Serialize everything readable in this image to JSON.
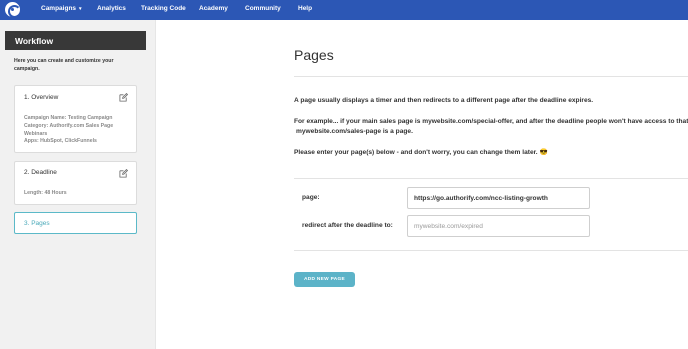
{
  "nav": {
    "items": [
      "Campaigns",
      "Analytics",
      "Tracking Code",
      "Academy",
      "Community",
      "Help"
    ],
    "campaigns_caret": "▾",
    "bg_color": "#2c57b5"
  },
  "sidebar": {
    "heading": "Workflow",
    "description": "Here you can create and customize your campaign.",
    "overview": {
      "title": "1. Overview",
      "campaign_name": "Campaign Name: Testing Campaign",
      "category": "Category: Authorify.com Sales Page Webinars",
      "apps": "Apps: HubSpot, ClickFunnels"
    },
    "deadline": {
      "title": "2. Deadline",
      "length": "Length: 48 Hours"
    },
    "pages": {
      "title": "3. Pages"
    }
  },
  "main": {
    "title": "Pages",
    "para1": "A page usually displays a timer and then redirects to a different page after the deadline expires.",
    "para2_line1": "For example... if your main sales page is mywebsite.com/special-offer, and after the deadline people won't have access to that page,",
    "para2_line2": "mywebsite.com/sales-page is a page.",
    "para3": "Please enter your page(s) below - and don't worry, you can change them later. 😎",
    "page_label": "page:",
    "page_value": "https://go.authorify.com/ncc-listing-growth",
    "redirect_label": "redirect after the deadline to:",
    "redirect_placeholder": "mywebsite.com/expired",
    "add_button": "ADD NEW PAGE",
    "accent_color": "#5cb3c8"
  }
}
